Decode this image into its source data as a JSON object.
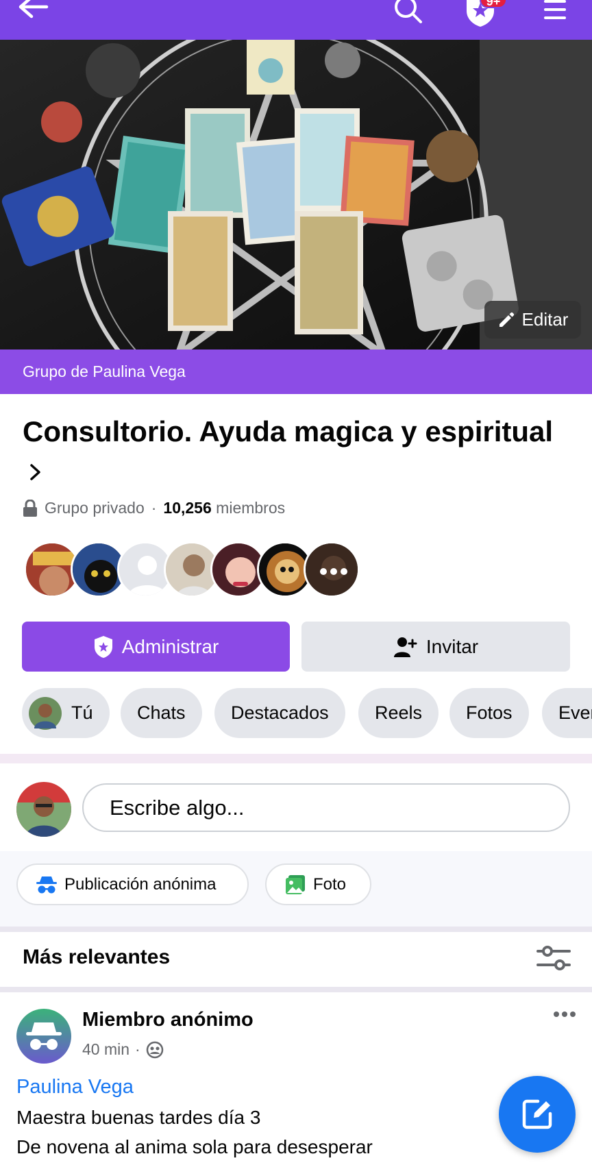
{
  "topbar": {
    "back_icon": "arrow-left-icon",
    "search_icon": "search-icon",
    "badge_icon": "shield-star-icon",
    "badge_count": "9+",
    "menu_icon": "hamburger-menu-icon",
    "color": "#7b44e6"
  },
  "cover": {
    "edit_label": "Editar",
    "edit_icon": "pencil-icon"
  },
  "group": {
    "owner_label": "Grupo de Paulina Vega",
    "title": "Consultorio. Ayuda magica y espiritual",
    "privacy": "Grupo privado",
    "separator": "·",
    "member_count": "10,256",
    "members_label": "miembros"
  },
  "actions": {
    "admin_label": "Administrar",
    "invite_label": "Invitar"
  },
  "tabs": [
    {
      "label": "Tú"
    },
    {
      "label": "Chats"
    },
    {
      "label": "Destacados"
    },
    {
      "label": "Reels"
    },
    {
      "label": "Fotos"
    },
    {
      "label": "Even"
    }
  ],
  "composer": {
    "placeholder": "Escribe algo...",
    "anon_label": "Publicación anónima",
    "photo_label": "Foto"
  },
  "feed": {
    "sort_label": "Más relevantes"
  },
  "post": {
    "author": "Miembro anónimo",
    "time": "40 min",
    "separator": "·",
    "tag": "Paulina Vega",
    "lines": [
      "Maestra buenas tardes día 3",
      "De novena al anima sola para desesperar"
    ]
  },
  "colors": {
    "accent": "#8b4ae6",
    "link": "#1877f2"
  }
}
